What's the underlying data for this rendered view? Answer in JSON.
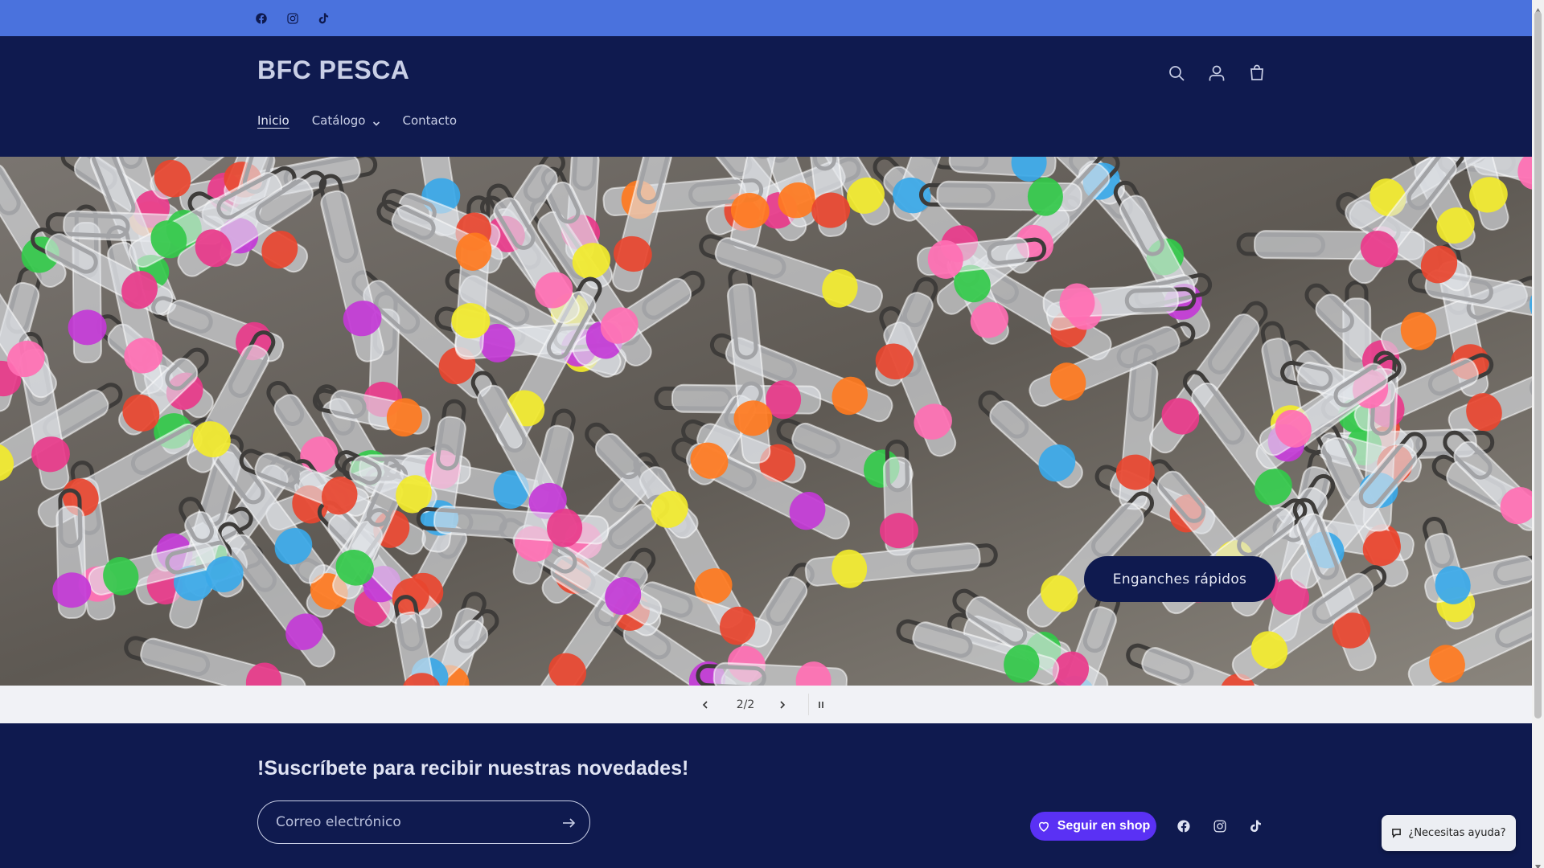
{
  "topbar": {
    "social": [
      {
        "name": "facebook-icon"
      },
      {
        "name": "instagram-icon"
      },
      {
        "name": "tiktok-icon"
      }
    ]
  },
  "header": {
    "logo": "BFC PESCA",
    "icons": [
      "search-icon",
      "account-icon",
      "cart-icon"
    ],
    "nav": [
      {
        "label": "Inicio",
        "active": true
      },
      {
        "label": "Catálogo",
        "dropdown": true
      },
      {
        "label": "Contacto"
      }
    ]
  },
  "hero": {
    "button_label": "Enganches rápidos",
    "slide_counter": "2/2",
    "controls": [
      "chevron-left-icon",
      "chevron-right-icon",
      "pause-icon"
    ]
  },
  "footer": {
    "newsletter_title": "!Suscríbete para recibir nuestras novedades!",
    "email_placeholder": "Correo electrónico",
    "shop_follow_label": "Seguir en shop",
    "social": [
      "facebook-icon",
      "instagram-icon",
      "tiktok-icon"
    ]
  },
  "help_chip": {
    "label": "¿Necesitas ayuda?"
  },
  "colors": {
    "topbar": "#4a72dd",
    "header_bg": "#0f1a4f",
    "shop_purple": "#5a31f4",
    "controls_bg": "#f1f2f6"
  }
}
